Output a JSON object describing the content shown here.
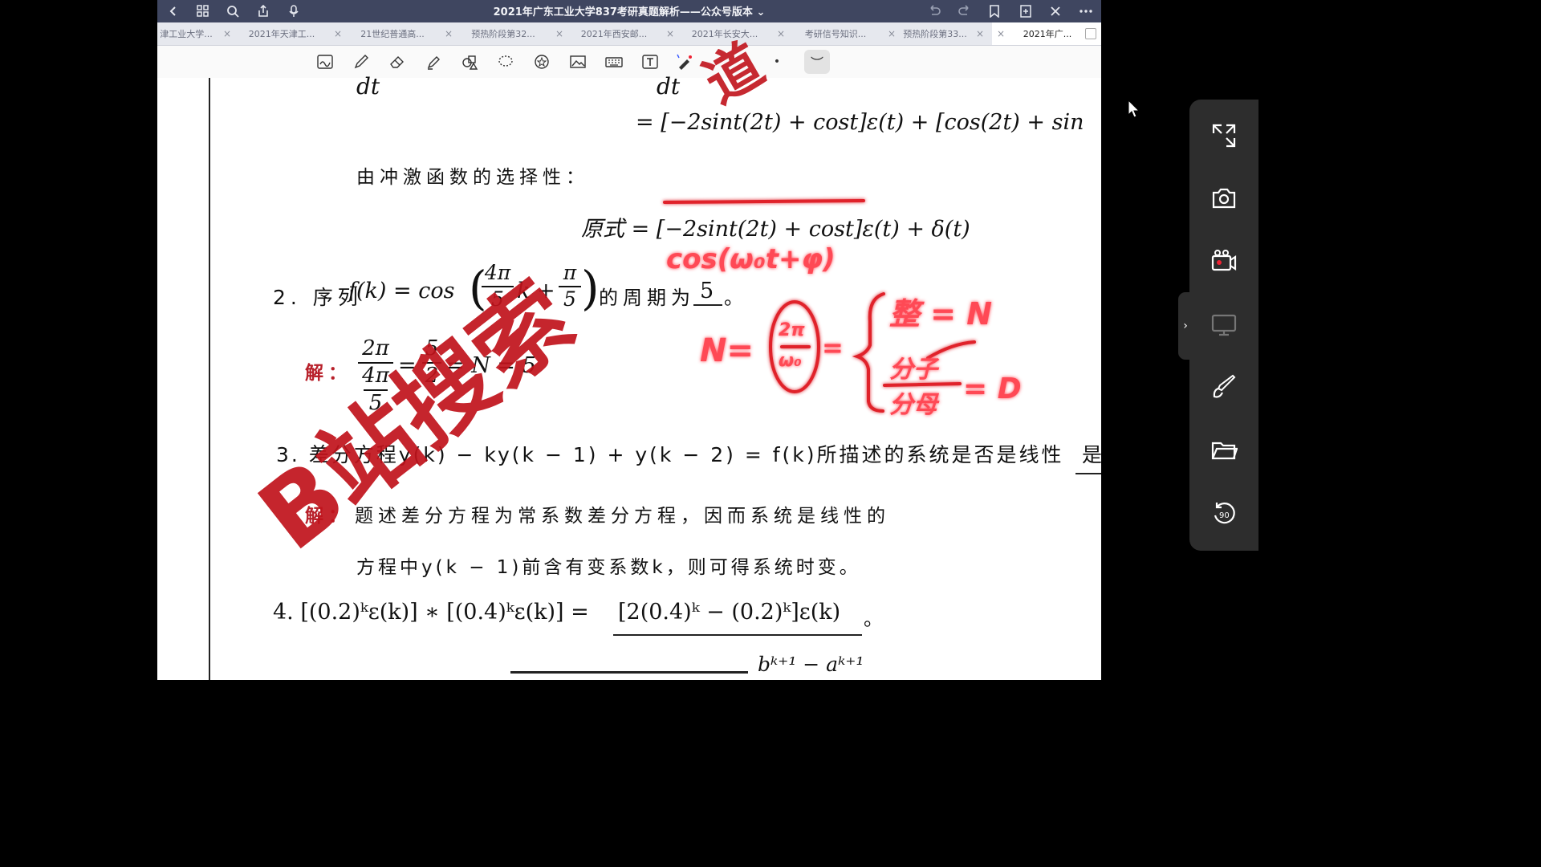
{
  "window": {
    "title": "2021年广东工业大学837考研真题解析——公众号版本",
    "title_chevron": "⌄"
  },
  "tabs": [
    {
      "label": "津工业大学...",
      "close": "×"
    },
    {
      "label": "2021年天津工...",
      "close": "×"
    },
    {
      "label": "21世纪普通高...",
      "close": "×"
    },
    {
      "label": "预热阶段第32...",
      "close": "×"
    },
    {
      "label": "2021年西安邮...",
      "close": "×"
    },
    {
      "label": "2021年长安大...",
      "close": "×"
    },
    {
      "label": "考研信号知识...",
      "close": "×"
    },
    {
      "label": "预热阶段第33...",
      "close": "×"
    },
    {
      "label": "2021年广...",
      "close": "×",
      "active": true
    }
  ],
  "toolbar": {
    "tools": [
      "scan-icon",
      "pen-icon",
      "eraser-icon",
      "highlighter-icon",
      "shapes-icon",
      "lasso-icon",
      "sticker-icon",
      "image-icon",
      "keyboard-icon",
      "text-box-icon",
      "laser-pointer-icon"
    ],
    "dot": "•",
    "active_stroke": "︶"
  },
  "document": {
    "top_left_fragment": "dt",
    "top_mid_fragment": "dt",
    "line1": "= [−2sint(2t) + cost]ε(t) + [cos(2t) + sin",
    "line2": "由冲激函数的选择性：",
    "line3": "原式 = [−2sint(2t) + cost]ε(t) + δ(t)",
    "q2_prefix": "2. 序列",
    "q2_func": "f(k) = cos",
    "q2_inner": "k +",
    "q2_num1": "4π",
    "q2_den1": "5",
    "q2_num2": "π",
    "q2_den2": "5",
    "q2_suffix": "的周期为",
    "q2_answer": "5",
    "q2_end": "。",
    "sol_label": "解：",
    "sol_num": "2π",
    "sol_den_num": "4π",
    "sol_den_den": "5",
    "sol_eq1": "=",
    "sol_frac_num": "5",
    "sol_frac_den": "2",
    "sol_tail": "= N = 5",
    "q3": "3. 差分方程y(k) − ky(k − 1) + y(k − 2) = f(k)所描述的系统是否是线性",
    "q3_answer": "是",
    "q3_sol1_label": "解：",
    "q3_sol1": "题述差分方程为常系数差分方程，因而系统是线性的",
    "q3_sol2": "方程中y(k − 1)前含有变系数k，则可得系统时变。",
    "q4": "4. [(0.2)ᵏε(k)] ∗ [(0.4)ᵏε(k)] =",
    "q4_answer": "[2(0.4)ᵏ − (0.2)ᵏ]ε(k)",
    "q4_end": "。",
    "bottom_fragment": "bᵏ⁺¹ − aᵏ⁺¹"
  },
  "handwriting": {
    "formula_top": "cos(ω₀t+φ)",
    "n_label": "N=",
    "n_frac_num": "2π",
    "n_frac_den": "ω₀",
    "case1": "整 = N",
    "case2_num": "分子",
    "case2_den": "分母",
    "case2_tail": "= D"
  },
  "watermark": {
    "text": "B站搜索",
    "extra": "道"
  },
  "side_panel": {
    "icons": [
      "collapse-icon",
      "screenshot-icon",
      "record-icon",
      "screen-cast-icon",
      "brush-icon",
      "folder-icon",
      "rotate-90-icon"
    ],
    "rotate_label": "90"
  },
  "colors": {
    "titlebar": "#3f4660",
    "tabbar": "#e6e8ee",
    "ink_red": "#c4141e",
    "side_panel": "#2d2d2d"
  }
}
